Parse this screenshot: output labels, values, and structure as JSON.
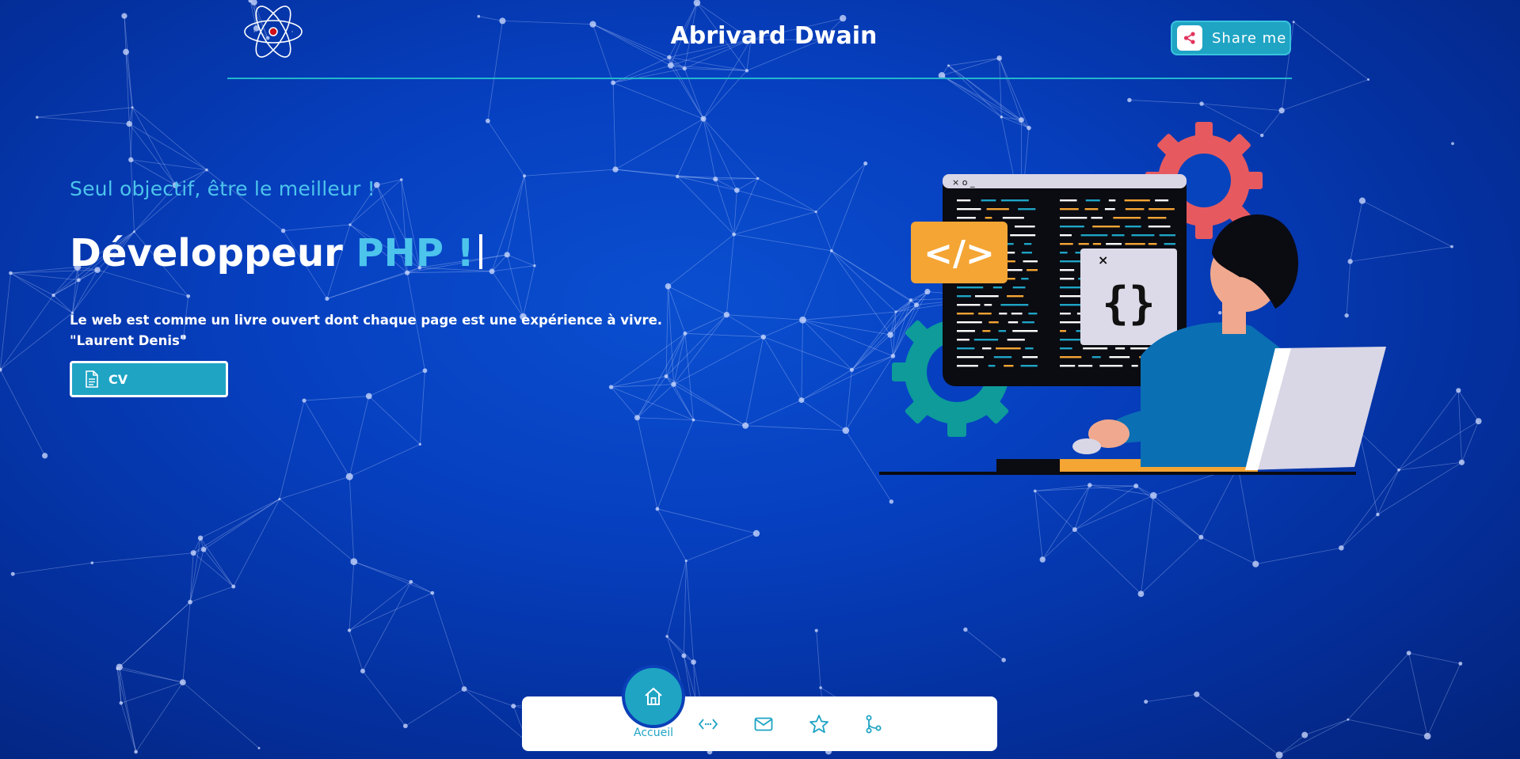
{
  "header": {
    "title": "Abrivard Dwain",
    "share_label": "Share me",
    "logo_icon": "atom-logo-icon"
  },
  "hero": {
    "tagline": "Seul objectif, être le meilleur !",
    "headline_prefix": "Développeur ",
    "headline_accent": "PHP !",
    "quote_line1": "Le web est comme un livre ouvert dont chaque page est une expérience à vivre.",
    "quote_line2": "\"Laurent Denis\"",
    "cv_label": "CV"
  },
  "bottom_nav": {
    "active_label": "Accueil",
    "items": [
      "home-icon",
      "code-icon",
      "mail-icon",
      "star-icon",
      "git-branch-icon"
    ]
  },
  "colors": {
    "accent": "#4cc4ec",
    "button": "#1fa4c4",
    "background": "#0640c0"
  }
}
